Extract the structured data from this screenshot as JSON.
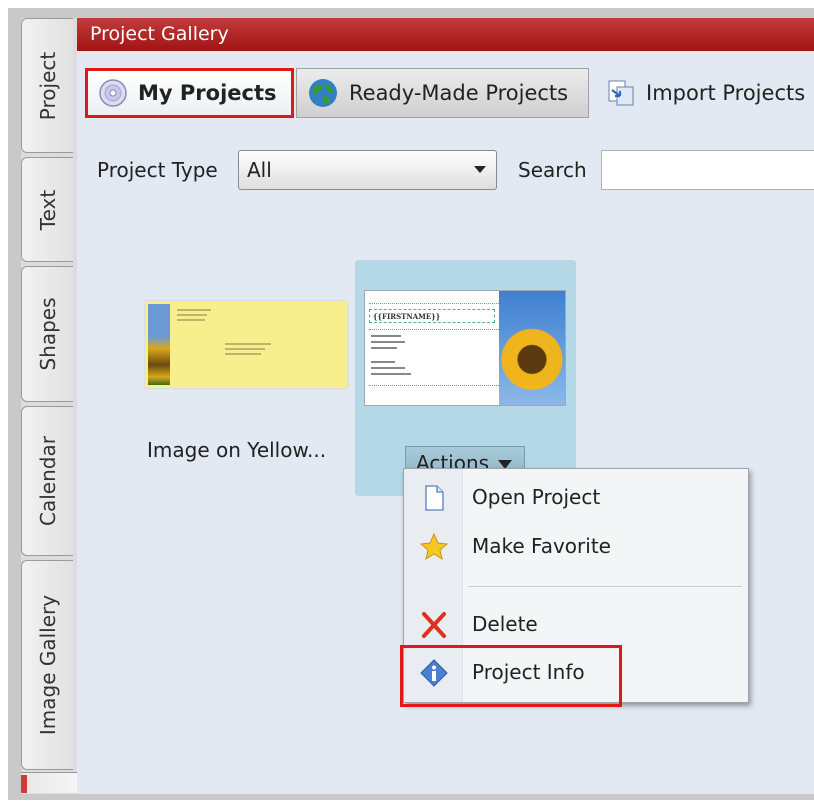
{
  "side_tabs": [
    "Project",
    "Text",
    "Shapes",
    "Calendar",
    "Image Gallery"
  ],
  "panel": {
    "title": "Project Gallery"
  },
  "toolbar": {
    "my_projects": "My Projects",
    "ready_made": "Ready-Made Projects",
    "import": "Import Projects"
  },
  "filters": {
    "type_label": "Project Type",
    "type_value": "All",
    "search_label": "Search"
  },
  "projects": [
    {
      "caption": "Image on Yellow..."
    },
    {
      "card_name_text": "{{FIRSTNAME}}",
      "actions_label": "Actions"
    }
  ],
  "actions_menu": {
    "items": [
      "Open Project",
      "Make Favorite",
      "Delete",
      "Project Info"
    ]
  },
  "colors": {
    "title_bar": "#b52020",
    "highlight_border": "#e01818",
    "selection_card": "#b4d8e6"
  }
}
